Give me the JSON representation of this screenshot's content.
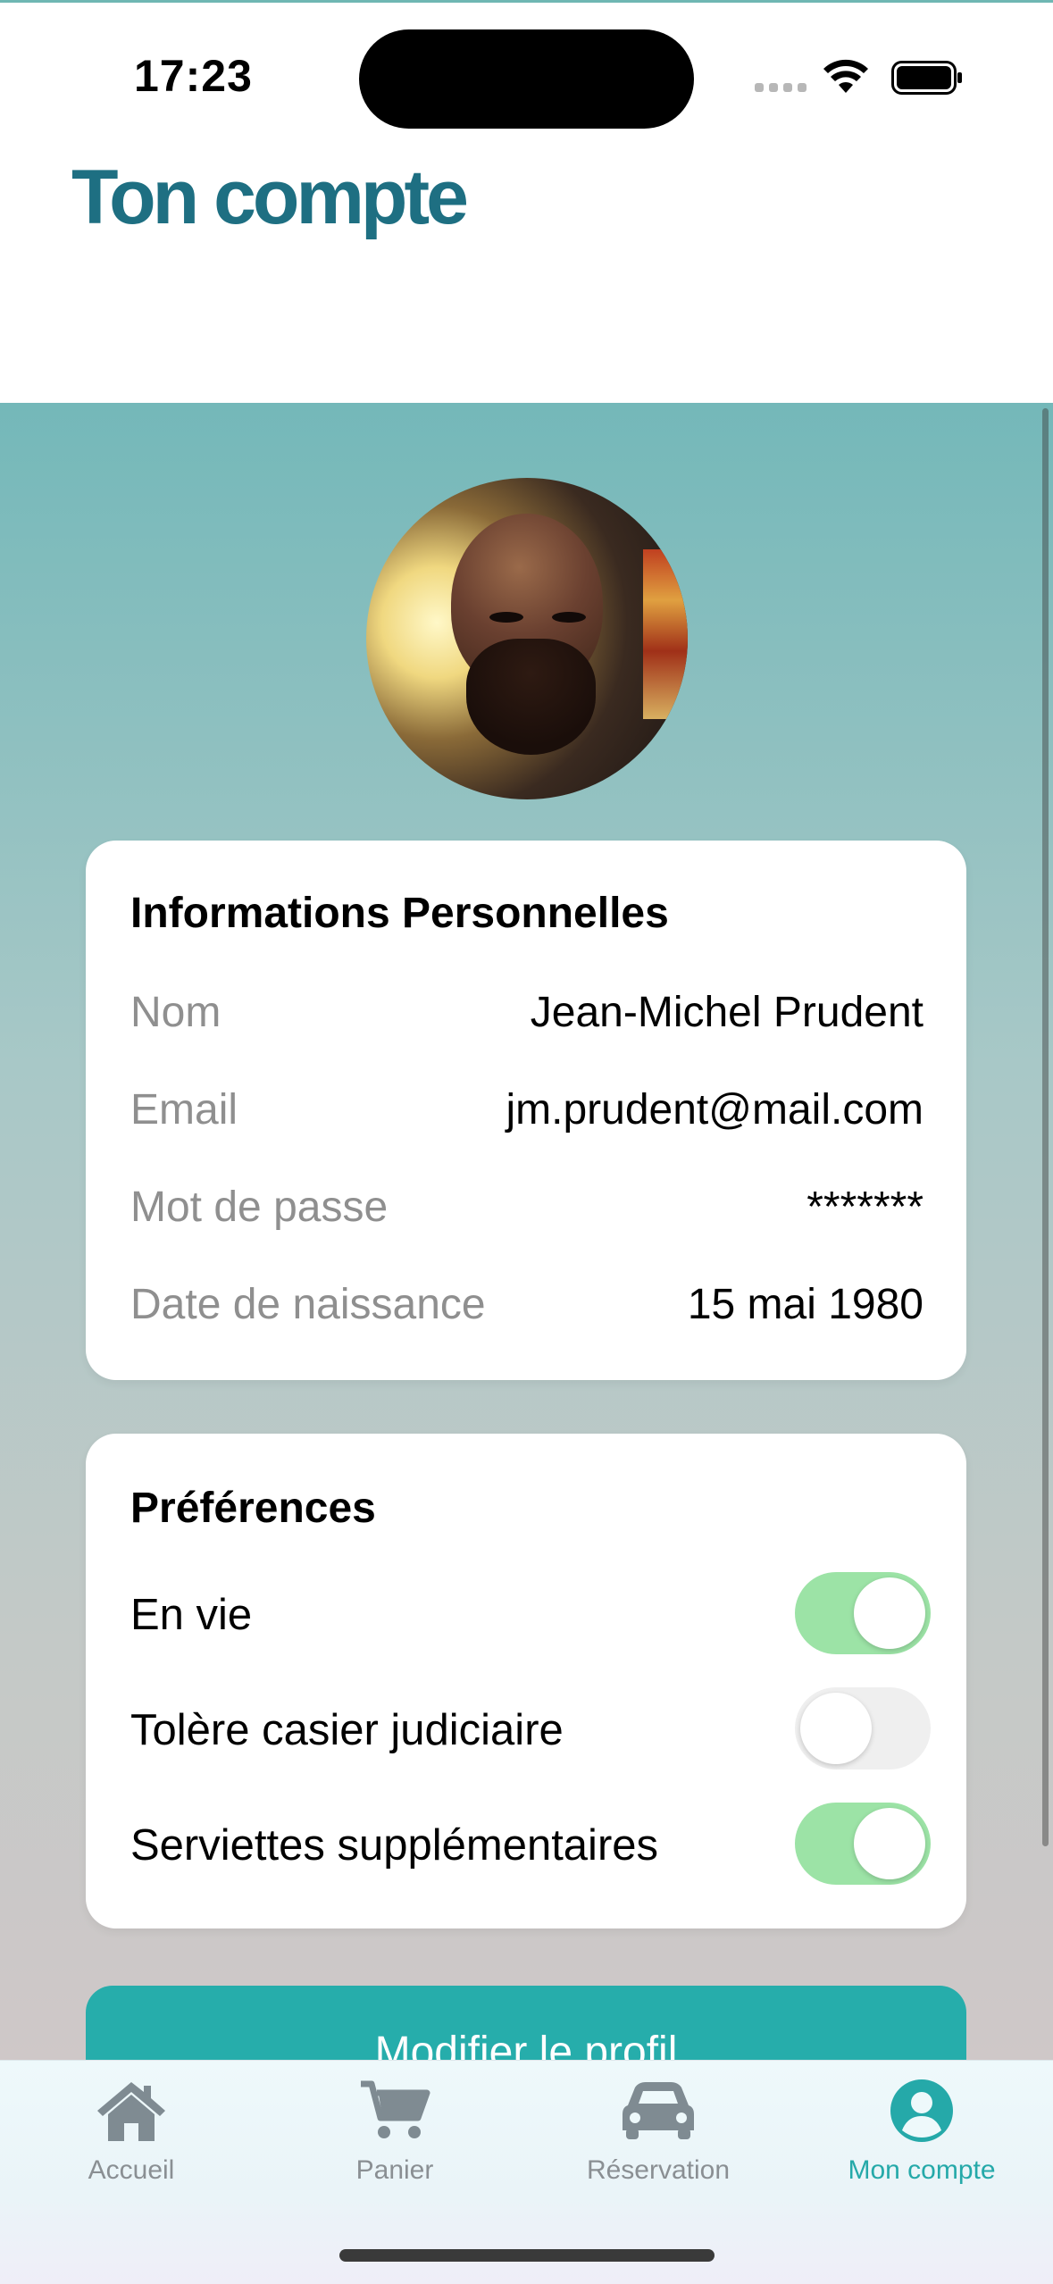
{
  "status_bar": {
    "time": "17:23"
  },
  "header": {
    "title": "Ton compte"
  },
  "personal_info": {
    "title": "Informations Personnelles",
    "rows": [
      {
        "label": "Nom",
        "value": "Jean-Michel Prudent"
      },
      {
        "label": "Email",
        "value": "jm.prudent@mail.com"
      },
      {
        "label": "Mot de passe",
        "value": "*******"
      },
      {
        "label": "Date de naissance",
        "value": "15 mai 1980"
      }
    ]
  },
  "preferences": {
    "title": "Préférences",
    "items": [
      {
        "label": "En vie",
        "enabled": true
      },
      {
        "label": "Tolère casier judiciaire",
        "enabled": false
      },
      {
        "label": "Serviettes supplémentaires",
        "enabled": true
      }
    ]
  },
  "actions": {
    "edit_profile_label": "Modifier le profil"
  },
  "tab_bar": {
    "tabs": [
      {
        "label": "Accueil",
        "icon": "house-icon",
        "active": false
      },
      {
        "label": "Panier",
        "icon": "cart-icon",
        "active": false
      },
      {
        "label": "Réservation",
        "icon": "car-icon",
        "active": false
      },
      {
        "label": "Mon compte",
        "icon": "person-circle-icon",
        "active": true
      }
    ]
  },
  "colors": {
    "title": "#1e6f82",
    "accent": "#26adab",
    "toggle_on": "#9ce3a6",
    "toggle_off": "#efefef",
    "tab_inactive": "#8a8f93",
    "tab_active": "#25a9a9"
  }
}
